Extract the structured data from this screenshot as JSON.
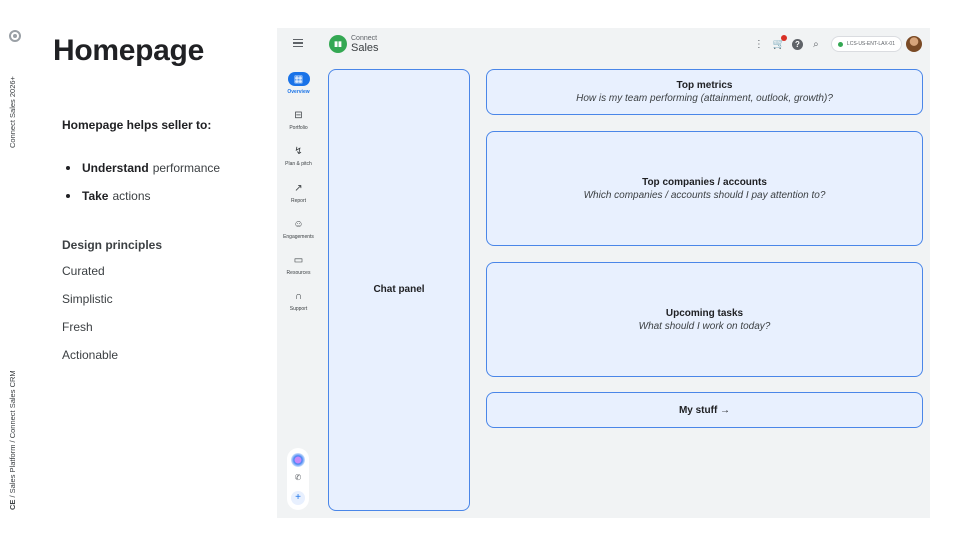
{
  "side": {
    "top_text": "Connect Sales 2026+",
    "bottom_prefix": "CE",
    "bottom_rest": "/  Sales Platform  /  Connect Sales CRM"
  },
  "slide": {
    "title": "Homepage",
    "intro": "Homepage helps seller to:",
    "bullets": [
      {
        "bold": "Understand",
        "rest": "performance"
      },
      {
        "bold": "Take",
        "rest": "actions"
      }
    ],
    "principles_title": "Design principles",
    "principles": [
      "Curated",
      "Simplistic",
      "Fresh",
      "Actionable"
    ]
  },
  "app": {
    "brand_small": "Connect",
    "brand_big": "Sales",
    "account": "LCS-US-ENT-LAX-01",
    "nav": [
      {
        "label": "Overview",
        "icon": "dashboard-icon",
        "glyph": "▦",
        "active": true
      },
      {
        "label": "Portfolio",
        "icon": "briefcase-icon",
        "glyph": "⊟",
        "active": false
      },
      {
        "label": "Plan & pitch",
        "icon": "route-icon",
        "glyph": "↯",
        "active": false
      },
      {
        "label": "Report",
        "icon": "chart-icon",
        "glyph": "↗",
        "active": false
      },
      {
        "label": "Engagements",
        "icon": "person-card-icon",
        "glyph": "☺",
        "active": false
      },
      {
        "label": "Resources",
        "icon": "resources-icon",
        "glyph": "▭",
        "active": false
      },
      {
        "label": "Support",
        "icon": "headset-icon",
        "glyph": "∩",
        "active": false
      }
    ],
    "panels": {
      "chat": {
        "title": "Chat panel"
      },
      "metrics": {
        "title": "Top metrics",
        "sub": "How is my team performing (attainment, outlook, growth)?"
      },
      "companies": {
        "title": "Top companies / accounts",
        "sub": "Which companies / accounts should I pay attention to?"
      },
      "tasks": {
        "title": "Upcoming tasks",
        "sub": "What should I work on today?"
      },
      "mystuff": {
        "title": "My stuff →"
      }
    }
  },
  "colors": {
    "accent": "#1a73e8",
    "panel_fill": "#e8f0fe",
    "panel_border": "#4a86e8",
    "app_background": "#f1f3f4"
  }
}
